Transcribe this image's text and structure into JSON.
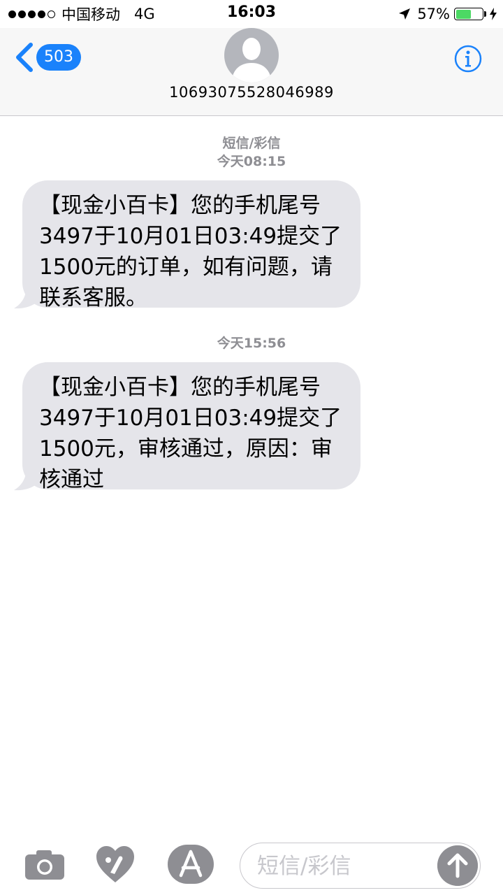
{
  "status_bar": {
    "carrier": "中国移动",
    "network": "4G",
    "time": "16:03",
    "battery_percent": "57%",
    "battery_level": 0.57,
    "signal_dots_filled": 4,
    "signal_dots_total": 5,
    "icons": [
      "location-arrow-icon",
      "battery-icon",
      "charging-bolt-icon"
    ],
    "battery_color": "#4cd964"
  },
  "header": {
    "back_count": "503",
    "contact_number": "10693075528046989",
    "accent_color": "#1a82fb",
    "icons": [
      "chevron-left-icon",
      "avatar-icon",
      "info-icon"
    ]
  },
  "thread": {
    "service_label": "短信/彩信",
    "messages": [
      {
        "timestamp": "今天08:15",
        "lines": [
          "【现金小百卡】您的手机尾号",
          "3497于10月01日03:49提交了",
          "1500元的订单，如有问题，请",
          "联系客服。"
        ]
      },
      {
        "timestamp": "今天15:56",
        "lines": [
          "【现金小百卡】您的手机尾号",
          "3497于10月01日03:49提交了",
          "1500元，审核通过，原因：审",
          "核通过"
        ]
      }
    ]
  },
  "composer": {
    "placeholder": "短信/彩信",
    "icons": [
      "camera-icon",
      "digital-touch-icon",
      "app-store-icon",
      "send-arrow-icon"
    ]
  }
}
